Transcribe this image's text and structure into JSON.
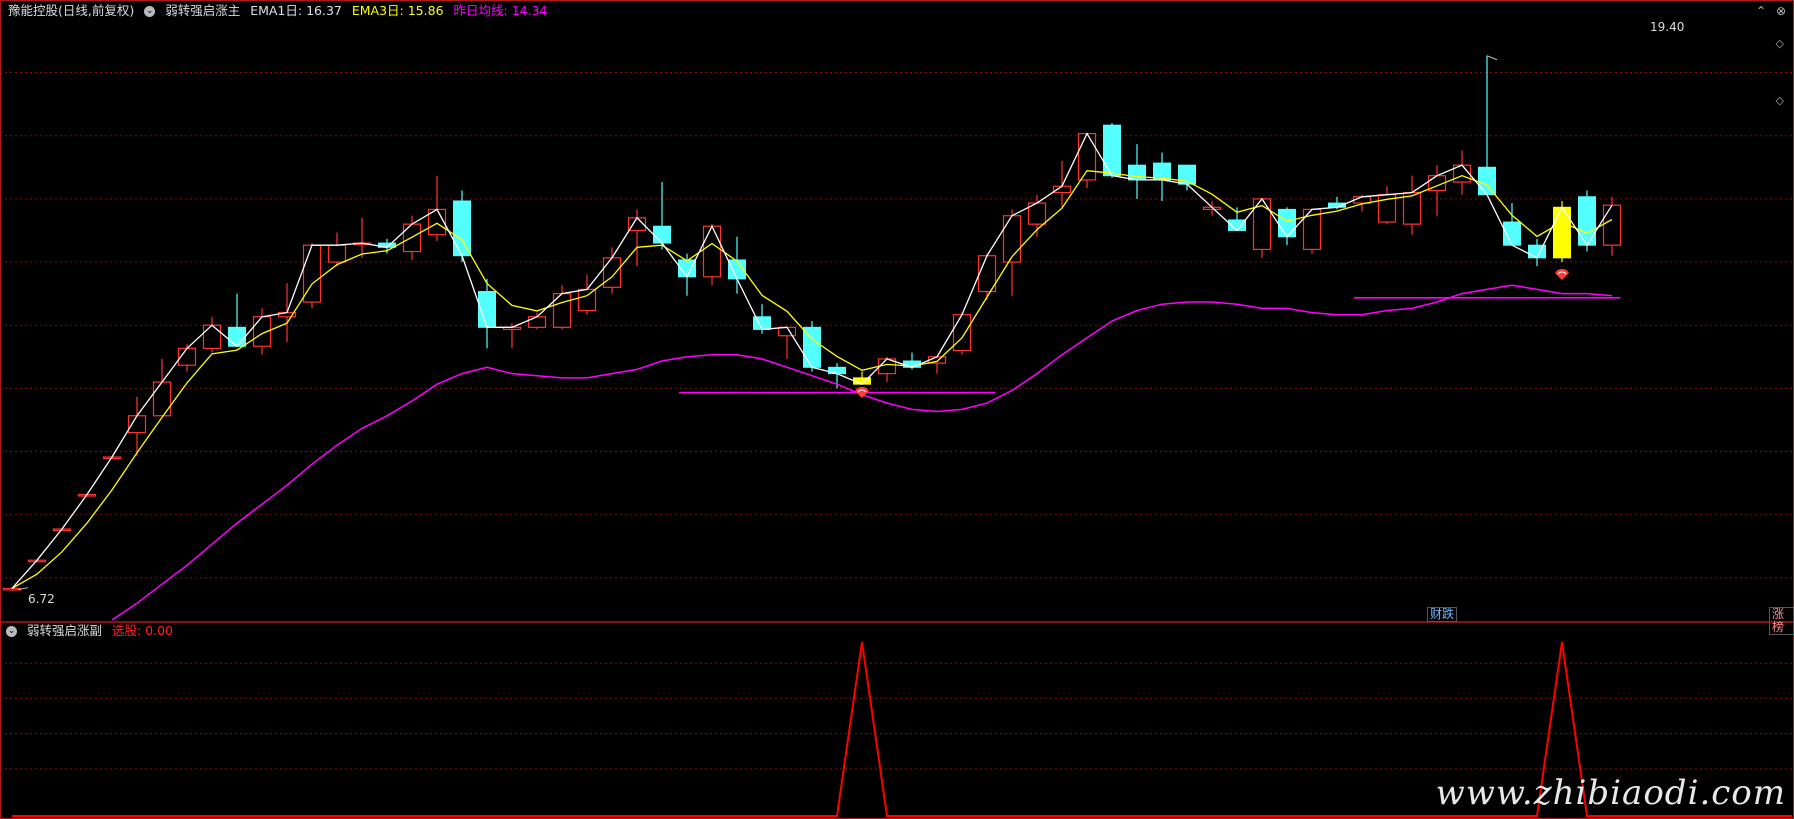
{
  "main_header": {
    "stock_name": "豫能控股(日线,前复权)",
    "indicator_name": "弱转强启涨主",
    "ema1_label": "EMA1日: 16.37",
    "ema3_label": "EMA3日: 15.86",
    "avg_label": "昨日均线: 14.34"
  },
  "sub_header": {
    "indicator_name": "弱转强启涨副",
    "signal_label": "选股: 0.00"
  },
  "badges": {
    "left": "财跌",
    "right": "涨榜"
  },
  "price_labels": {
    "high": "19.40",
    "low": "6.72"
  },
  "watermark": "www.zhibiaodi.com",
  "colors": {
    "up": "#ff3232",
    "down": "#54ffff",
    "ema1": "#ffffff",
    "ema3": "#ffff00",
    "avg": "#ff00ff",
    "signal": "#ff0000",
    "highlight": "#ffff00",
    "grid": "#801010"
  },
  "chart_data": [
    {
      "type": "candlestick",
      "title": "弱转强启涨主",
      "ylim": [
        6.0,
        20.2
      ],
      "gridlines": [
        19.0,
        17.5,
        16.0,
        14.5,
        13.0,
        11.5,
        10.0,
        8.5,
        7.0
      ],
      "candles": [
        {
          "o": 6.72,
          "h": 6.78,
          "l": 6.68,
          "c": 6.75
        },
        {
          "o": 7.41,
          "h": 7.43,
          "l": 7.39,
          "c": 7.42
        },
        {
          "o": 8.15,
          "h": 8.17,
          "l": 8.13,
          "c": 8.16
        },
        {
          "o": 8.97,
          "h": 8.99,
          "l": 8.95,
          "c": 8.98
        },
        {
          "o": 9.86,
          "h": 9.88,
          "l": 9.84,
          "c": 9.87
        },
        {
          "o": 10.45,
          "h": 11.3,
          "l": 9.9,
          "c": 10.85
        },
        {
          "o": 10.85,
          "h": 12.2,
          "l": 10.85,
          "c": 11.65
        },
        {
          "o": 12.05,
          "h": 12.55,
          "l": 11.9,
          "c": 12.45
        },
        {
          "o": 12.45,
          "h": 13.2,
          "l": 12.35,
          "c": 13.0
        },
        {
          "o": 12.95,
          "h": 13.75,
          "l": 12.8,
          "c": 12.5
        },
        {
          "o": 12.5,
          "h": 13.4,
          "l": 12.3,
          "c": 13.2
        },
        {
          "o": 13.2,
          "h": 14.0,
          "l": 12.6,
          "c": 13.3
        },
        {
          "o": 13.55,
          "h": 14.95,
          "l": 13.4,
          "c": 14.9
        },
        {
          "o": 14.5,
          "h": 15.2,
          "l": 14.4,
          "c": 14.9
        },
        {
          "o": 14.95,
          "h": 15.55,
          "l": 14.6,
          "c": 14.95
        },
        {
          "o": 14.95,
          "h": 15.05,
          "l": 14.7,
          "c": 14.85
        },
        {
          "o": 14.75,
          "h": 15.6,
          "l": 14.55,
          "c": 15.4
        },
        {
          "o": 15.15,
          "h": 16.55,
          "l": 15.0,
          "c": 15.75
        },
        {
          "o": 15.95,
          "h": 16.2,
          "l": 14.5,
          "c": 14.65
        },
        {
          "o": 13.8,
          "h": 14.1,
          "l": 12.45,
          "c": 12.95
        },
        {
          "o": 12.9,
          "h": 13.05,
          "l": 12.45,
          "c": 12.95
        },
        {
          "o": 12.95,
          "h": 13.3,
          "l": 12.9,
          "c": 13.2
        },
        {
          "o": 12.95,
          "h": 13.95,
          "l": 12.9,
          "c": 13.75
        },
        {
          "o": 13.35,
          "h": 14.2,
          "l": 13.25,
          "c": 13.85
        },
        {
          "o": 13.9,
          "h": 14.85,
          "l": 13.75,
          "c": 14.6
        },
        {
          "o": 15.25,
          "h": 15.75,
          "l": 14.4,
          "c": 15.55
        },
        {
          "o": 15.35,
          "h": 16.4,
          "l": 14.8,
          "c": 14.95
        },
        {
          "o": 14.55,
          "h": 14.7,
          "l": 13.7,
          "c": 14.15
        },
        {
          "o": 14.15,
          "h": 15.4,
          "l": 13.95,
          "c": 15.35
        },
        {
          "o": 14.55,
          "h": 15.1,
          "l": 13.75,
          "c": 14.1
        },
        {
          "o": 13.2,
          "h": 13.5,
          "l": 12.8,
          "c": 12.9
        },
        {
          "o": 12.75,
          "h": 12.95,
          "l": 12.2,
          "c": 12.95
        },
        {
          "o": 12.95,
          "h": 13.1,
          "l": 11.9,
          "c": 12.0
        },
        {
          "o": 12.0,
          "h": 12.1,
          "l": 11.5,
          "c": 11.85
        },
        {
          "o": 11.75,
          "h": 11.9,
          "l": 11.7,
          "c": 11.6,
          "special": true
        },
        {
          "o": 11.85,
          "h": 12.25,
          "l": 11.65,
          "c": 12.2
        },
        {
          "o": 12.15,
          "h": 12.35,
          "l": 11.95,
          "c": 12.0
        },
        {
          "o": 12.1,
          "h": 12.25,
          "l": 11.85,
          "c": 12.25
        },
        {
          "o": 12.4,
          "h": 13.3,
          "l": 12.3,
          "c": 13.25
        },
        {
          "o": 13.8,
          "h": 14.7,
          "l": 13.6,
          "c": 14.65
        },
        {
          "o": 14.5,
          "h": 15.75,
          "l": 13.7,
          "c": 15.6
        },
        {
          "o": 15.4,
          "h": 16.1,
          "l": 15.1,
          "c": 15.9
        },
        {
          "o": 16.15,
          "h": 16.9,
          "l": 15.8,
          "c": 16.3
        },
        {
          "o": 16.45,
          "h": 17.55,
          "l": 16.25,
          "c": 17.55
        },
        {
          "o": 17.75,
          "h": 17.8,
          "l": 16.5,
          "c": 16.55
        },
        {
          "o": 16.8,
          "h": 17.3,
          "l": 16.0,
          "c": 16.45
        },
        {
          "o": 16.85,
          "h": 17.1,
          "l": 15.95,
          "c": 16.45
        },
        {
          "o": 16.8,
          "h": 16.8,
          "l": 16.2,
          "c": 16.35
        },
        {
          "o": 15.75,
          "h": 15.95,
          "l": 15.6,
          "c": 15.8
        },
        {
          "o": 15.5,
          "h": 15.8,
          "l": 15.3,
          "c": 15.25
        },
        {
          "o": 14.8,
          "h": 16.0,
          "l": 14.6,
          "c": 16.0
        },
        {
          "o": 15.75,
          "h": 15.8,
          "l": 14.9,
          "c": 15.1
        },
        {
          "o": 14.8,
          "h": 15.7,
          "l": 14.7,
          "c": 15.75
        },
        {
          "o": 15.9,
          "h": 16.05,
          "l": 15.75,
          "c": 15.8
        },
        {
          "o": 15.9,
          "h": 16.1,
          "l": 15.7,
          "c": 16.05
        },
        {
          "o": 15.45,
          "h": 16.3,
          "l": 15.4,
          "c": 16.1
        },
        {
          "o": 15.4,
          "h": 16.55,
          "l": 15.15,
          "c": 16.15
        },
        {
          "o": 16.2,
          "h": 16.8,
          "l": 15.6,
          "c": 16.55
        },
        {
          "o": 16.4,
          "h": 17.15,
          "l": 16.1,
          "c": 16.8
        },
        {
          "o": 16.75,
          "h": 19.4,
          "l": 16.75,
          "c": 16.1
        },
        {
          "o": 15.45,
          "h": 15.9,
          "l": 15.0,
          "c": 14.9
        },
        {
          "o": 14.9,
          "h": 15.05,
          "l": 14.4,
          "c": 14.6
        },
        {
          "o": 14.6,
          "h": 15.95,
          "l": 14.5,
          "c": 15.8,
          "special": true
        },
        {
          "o": 16.05,
          "h": 16.2,
          "l": 14.75,
          "c": 14.9
        },
        {
          "o": 14.9,
          "h": 16.05,
          "l": 14.65,
          "c": 15.85
        }
      ],
      "ema1": [
        6.75,
        7.42,
        8.16,
        8.98,
        9.87,
        10.85,
        11.65,
        12.45,
        13.0,
        12.5,
        13.2,
        13.3,
        14.9,
        14.9,
        14.95,
        14.85,
        15.4,
        15.75,
        14.65,
        12.95,
        12.95,
        13.2,
        13.75,
        13.85,
        14.6,
        15.55,
        14.95,
        14.15,
        15.35,
        14.1,
        12.9,
        12.95,
        12.0,
        11.85,
        11.6,
        12.2,
        12.0,
        12.25,
        13.25,
        14.65,
        15.6,
        15.9,
        16.3,
        17.55,
        16.55,
        16.45,
        16.45,
        16.35,
        15.8,
        15.25,
        16.0,
        15.1,
        15.75,
        15.8,
        16.05,
        16.1,
        16.15,
        16.55,
        16.8,
        16.1,
        14.9,
        14.6,
        15.8,
        14.9,
        15.85
      ],
      "ema3": [
        6.75,
        7.09,
        7.62,
        8.3,
        9.09,
        9.97,
        10.81,
        11.63,
        12.32,
        12.41,
        12.8,
        13.05,
        13.98,
        14.44,
        14.69,
        14.77,
        15.09,
        15.42,
        15.03,
        13.99,
        13.47,
        13.34,
        13.54,
        13.7,
        14.15,
        14.85,
        14.9,
        14.53,
        14.94,
        14.52,
        13.71,
        13.33,
        12.67,
        12.26,
        11.93,
        12.07,
        12.03,
        12.14,
        12.7,
        13.67,
        14.63,
        15.27,
        15.78,
        16.67,
        16.61,
        16.53,
        16.49,
        16.42,
        16.11,
        15.68,
        15.84,
        15.47,
        15.61,
        15.71,
        15.88,
        15.99,
        16.07,
        16.31,
        16.55,
        16.33,
        15.61,
        15.11,
        15.45,
        15.18,
        15.51
      ],
      "avg_line": [
        null,
        null,
        null,
        null,
        6.0,
        6.4,
        6.85,
        7.3,
        7.8,
        8.3,
        8.75,
        9.2,
        9.7,
        10.15,
        10.55,
        10.85,
        11.2,
        11.6,
        11.85,
        12.0,
        11.85,
        11.8,
        11.75,
        11.75,
        11.85,
        11.95,
        12.15,
        12.25,
        12.3,
        12.3,
        12.2,
        12.0,
        11.8,
        11.6,
        11.35,
        11.15,
        11.0,
        10.95,
        11.0,
        11.15,
        11.45,
        11.85,
        12.3,
        12.7,
        13.1,
        13.35,
        13.5,
        13.55,
        13.55,
        13.5,
        13.4,
        13.4,
        13.3,
        13.25,
        13.25,
        13.35,
        13.4,
        13.55,
        13.75,
        13.85,
        13.95,
        13.85,
        13.75,
        13.75,
        13.7
      ],
      "support_lines": [
        {
          "start": 27,
          "end": 39,
          "value": 11.4
        },
        {
          "start": 54,
          "end": 64,
          "value": 13.65
        }
      ],
      "signals": [
        34,
        62
      ]
    },
    {
      "type": "line",
      "title": "弱转强启涨副",
      "ylim": [
        0,
        1
      ],
      "series": [
        {
          "values": [
            0,
            0,
            0,
            0,
            0,
            0,
            0,
            0,
            0,
            0,
            0,
            0,
            0,
            0,
            0,
            0,
            0,
            0,
            0,
            0,
            0,
            0,
            0,
            0,
            0,
            0,
            0,
            0,
            0,
            0,
            0,
            0,
            0,
            0,
            1,
            0,
            0,
            0,
            0,
            0,
            0,
            0,
            0,
            0,
            0,
            0,
            0,
            0,
            0,
            0,
            0,
            0,
            0,
            0,
            0,
            0,
            0,
            0,
            0,
            0,
            0,
            0,
            1,
            0,
            0
          ]
        }
      ]
    }
  ]
}
